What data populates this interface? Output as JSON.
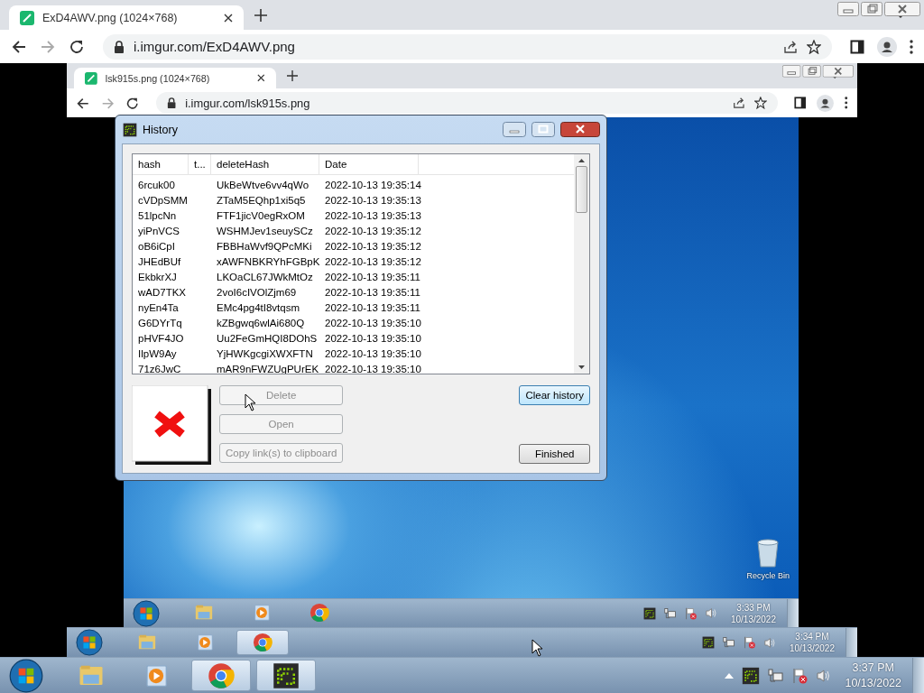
{
  "browser": {
    "tab_title": "ExD4AWV.png (1024×768)",
    "url": "i.imgur.com/ExD4AWV.png"
  },
  "embedded_browser": {
    "tab_title": "lsk915s.png (1024×768)",
    "url": "i.imgur.com/lsk915s.png",
    "desktop": {
      "recycle_bin": "Recycle Bin",
      "taskbar": {
        "items": [
          {
            "kind": "start"
          },
          {
            "kind": "explorer",
            "running": false
          },
          {
            "kind": "media",
            "running": false
          },
          {
            "kind": "chrome",
            "running": false
          }
        ],
        "time": "3:33 PM",
        "date": "10/13/2022"
      }
    },
    "taskbar": {
      "items": [
        {
          "kind": "start"
        },
        {
          "kind": "explorer",
          "running": false
        },
        {
          "kind": "media",
          "running": false
        },
        {
          "kind": "chrome",
          "running": true
        }
      ],
      "time": "3:34 PM",
      "date": "10/13/2022"
    }
  },
  "history_window": {
    "title": "History",
    "columns": [
      "hash",
      "t...",
      "deleteHash",
      "Date"
    ],
    "rows": [
      [
        "6rcuk00",
        "",
        "UkBeWtve6vv4qWo",
        "2022-10-13 19:35:14"
      ],
      [
        "cVDpSMM",
        "",
        "ZTaM5EQhp1xi5q5",
        "2022-10-13 19:35:13"
      ],
      [
        "51lpcNn",
        "",
        "FTF1jicV0egRxOM",
        "2022-10-13 19:35:13"
      ],
      [
        "yiPnVCS",
        "",
        "WSHMJev1seuySCz",
        "2022-10-13 19:35:12"
      ],
      [
        "oB6iCpI",
        "",
        "FBBHaWvf9QPcMKi",
        "2022-10-13 19:35:12"
      ],
      [
        "JHEdBUf",
        "",
        "xAWFNBKRYhFGBpK",
        "2022-10-13 19:35:12"
      ],
      [
        "EkbkrXJ",
        "",
        "LKOaCL67JWkMtOz",
        "2022-10-13 19:35:11"
      ],
      [
        "wAD7TKX",
        "",
        "2voI6cIVOlZjm69",
        "2022-10-13 19:35:11"
      ],
      [
        "nyEn4Ta",
        "",
        "EMc4pg4tI8vtqsm",
        "2022-10-13 19:35:11"
      ],
      [
        "G6DYrTq",
        "",
        "kZBgwq6wlAi680Q",
        "2022-10-13 19:35:10"
      ],
      [
        "pHVF4JO",
        "",
        "Uu2FeGmHQI8DOhS",
        "2022-10-13 19:35:10"
      ],
      [
        "IlpW9Ay",
        "",
        "YjHWKgcgiXWXFTN",
        "2022-10-13 19:35:10"
      ],
      [
        "71z6JwC",
        "",
        "mAR9nFWZUgPUrEK",
        "2022-10-13 19:35:10"
      ]
    ],
    "left_buttons": [
      {
        "label": "Delete",
        "disabled": true
      },
      {
        "label": "Open",
        "disabled": true
      },
      {
        "label": "Copy link(s) to clipboard",
        "disabled": true
      }
    ],
    "right_buttons": [
      {
        "label": "Clear history",
        "disabled": false
      },
      {
        "label": "Finished",
        "disabled": false
      }
    ]
  },
  "taskbar": {
    "items": [
      {
        "kind": "start"
      },
      {
        "kind": "explorer",
        "running": false
      },
      {
        "kind": "media",
        "running": false
      },
      {
        "kind": "chrome",
        "running": true
      },
      {
        "kind": "greenshot",
        "running": true
      }
    ],
    "show_hidden": true,
    "time": "3:37 PM",
    "date": "10/13/2022"
  }
}
